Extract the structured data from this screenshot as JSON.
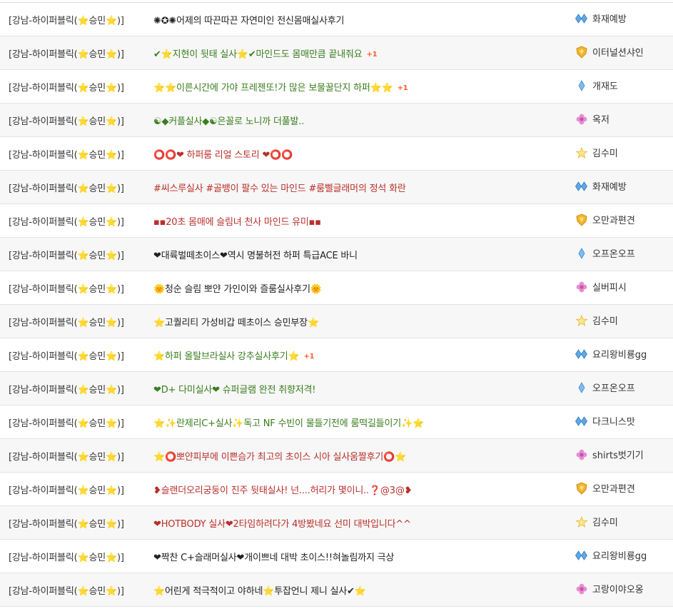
{
  "posts": [
    {
      "shop": "[강남-하이퍼블릭(⭐승민⭐)]",
      "title": "✺✪✺어제의 따끈따끈 자연미인 전신몸매실사후기",
      "color": "black",
      "comments": "",
      "level": "double-diamond",
      "author": "화재예방"
    },
    {
      "shop": "[강남-하이퍼블릭(⭐승민⭐)]",
      "title": "✔⭐지현이 뒷태 실사⭐✔마인드도 몸매만큼 끝내줘요",
      "color": "green",
      "comments": "+1",
      "level": "gold-shield",
      "author": "이터널션샤인"
    },
    {
      "shop": "[강남-하이퍼블릭(⭐승민⭐)]",
      "title": "⭐⭐이른시간에 가야 프레젠또!가 많은 보물꿀단지 하퍼⭐⭐",
      "color": "green",
      "comments": "+1",
      "level": "diamond",
      "author": "개재도"
    },
    {
      "shop": "[강남-하이퍼블릭(⭐승민⭐)]",
      "title": "☯◆커플실사◆☯은꼴로 노니까 더풀발..",
      "color": "green",
      "comments": "",
      "level": "flower",
      "author": "옥저"
    },
    {
      "shop": "[강남-하이퍼블릭(⭐승민⭐)]",
      "title": "⭕⭕❤ 하퍼룸 리얼 스토리 ❤⭕⭕",
      "color": "red",
      "comments": "",
      "level": "star",
      "author": "김수미"
    },
    {
      "shop": "[강남-하이퍼블릭(⭐승민⭐)]",
      "title": "#씨스루실사 #골뱅이 팔수 있는 마인드 #룸삘글래머의 정석 화란",
      "color": "red",
      "comments": "",
      "level": "double-diamond",
      "author": "화재예방"
    },
    {
      "shop": "[강남-하이퍼블릭(⭐승민⭐)]",
      "title": "▪▪20초 몸매에 슬림녀 천사 마인드 유미▪▪",
      "color": "red",
      "comments": "",
      "level": "gold-shield",
      "author": "오만과편견"
    },
    {
      "shop": "[강남-하이퍼블릭(⭐승민⭐)]",
      "title": "❤대륙벌떼초이스❤역시 명불허전 하퍼 특급ACE 바니",
      "color": "black",
      "comments": "",
      "level": "diamond",
      "author": "오프온오프"
    },
    {
      "shop": "[강남-하이퍼블릭(⭐승민⭐)]",
      "title": "🌞청순 슬림 뽀얀 가인이와 즐룸실사후기🌞",
      "color": "black",
      "comments": "",
      "level": "flower",
      "author": "실버피시"
    },
    {
      "shop": "[강남-하이퍼블릭(⭐승민⭐)]",
      "title": "⭐고퀄리티 가성비갑 떼초이스 승민부장⭐",
      "color": "black",
      "comments": "",
      "level": "star",
      "author": "김수미"
    },
    {
      "shop": "[강남-하이퍼블릭(⭐승민⭐)]",
      "title": "⭐하퍼 올탈브라실사 강추실사후기⭐",
      "color": "green",
      "comments": "+1",
      "level": "double-diamond",
      "author": "요리왕비룡gg"
    },
    {
      "shop": "[강남-하이퍼블릭(⭐승민⭐)]",
      "title": "❤D+ 다미실사❤ 슈퍼글램 완전 취향저격!",
      "color": "green",
      "comments": "",
      "level": "diamond",
      "author": "오프온오프"
    },
    {
      "shop": "[강남-하이퍼블릭(⭐승민⭐)]",
      "title": "⭐✨란제리C+실사✨독고 NF 수빈이 물들기전에 룸떡길들이기✨⭐",
      "color": "green",
      "comments": "",
      "level": "double-diamond",
      "author": "다크니스맛"
    },
    {
      "shop": "[강남-하이퍼블릭(⭐승민⭐)]",
      "title": "⭐⭕뽀얀피부에 이쁜슴가 최고의 초이스 시아 실사움짤후기⭕⭐",
      "color": "red",
      "comments": "",
      "level": "flower",
      "author": "shirts벗기기"
    },
    {
      "shop": "[강남-하이퍼블릭(⭐승민⭐)]",
      "title": "❥슬랜더오리궁둥이 진주 뒷태실사! 넌....허리가 몇이니..❓@3@❥",
      "color": "red",
      "comments": "",
      "level": "gold-shield",
      "author": "오만과편견"
    },
    {
      "shop": "[강남-하이퍼블릭(⭐승민⭐)]",
      "title": "❤HOTBODY 실사❤2타임하려다가 4방봤네요 선미 대박입니다^^",
      "color": "red",
      "comments": "",
      "level": "star",
      "author": "김수미"
    },
    {
      "shop": "[강남-하이퍼블릭(⭐승민⭐)]",
      "title": "❤짝찬 C+슬래머실사❤개이쁘네 대박 초이스!!혀놀림까지 극상",
      "color": "black",
      "comments": "",
      "level": "double-diamond",
      "author": "요리왕비룡gg"
    },
    {
      "shop": "[강남-하이퍼블릭(⭐승민⭐)]",
      "title": "⭐어린게 적극적이고 야하네⭐투잡언니 제니 실사✔⭐",
      "color": "black",
      "comments": "",
      "level": "flower",
      "author": "고랑이야오옹"
    }
  ],
  "colors": {
    "green": "#3a7d1e",
    "red": "#b8302a",
    "black": "#222222",
    "comment": "#ff5a2a",
    "star": "#f2b705"
  }
}
